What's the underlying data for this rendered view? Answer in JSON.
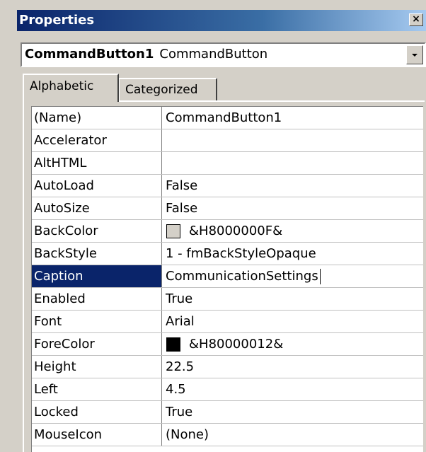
{
  "window": {
    "title": "Properties",
    "close_glyph": "×"
  },
  "object_selector": {
    "name": "CommandButton1",
    "type": "CommandButton"
  },
  "tabs": [
    {
      "label": "Alphabetic",
      "active": true
    },
    {
      "label": "Categorized",
      "active": false
    }
  ],
  "properties": [
    {
      "name": "(Name)",
      "value": "CommandButton1"
    },
    {
      "name": "Accelerator",
      "value": ""
    },
    {
      "name": "AltHTML",
      "value": ""
    },
    {
      "name": "AutoLoad",
      "value": "False"
    },
    {
      "name": "AutoSize",
      "value": "False"
    },
    {
      "name": "BackColor",
      "value": "&H8000000F&",
      "swatch": "#d4d0c8"
    },
    {
      "name": "BackStyle",
      "value": "1 - fmBackStyleOpaque"
    },
    {
      "name": "Caption",
      "value": "CommunicationSettings",
      "selected": true
    },
    {
      "name": "Enabled",
      "value": "True"
    },
    {
      "name": "Font",
      "value": "Arial"
    },
    {
      "name": "ForeColor",
      "value": "&H80000012&",
      "swatch": "#000000"
    },
    {
      "name": "Height",
      "value": "22.5"
    },
    {
      "name": "Left",
      "value": "4.5"
    },
    {
      "name": "Locked",
      "value": "True"
    },
    {
      "name": "MouseIcon",
      "value": "(None)"
    }
  ],
  "colors": {
    "selection": "#0a246a",
    "titlebar_start": "#0a246a",
    "titlebar_end": "#a6caf0",
    "face": "#d4d0c8"
  }
}
